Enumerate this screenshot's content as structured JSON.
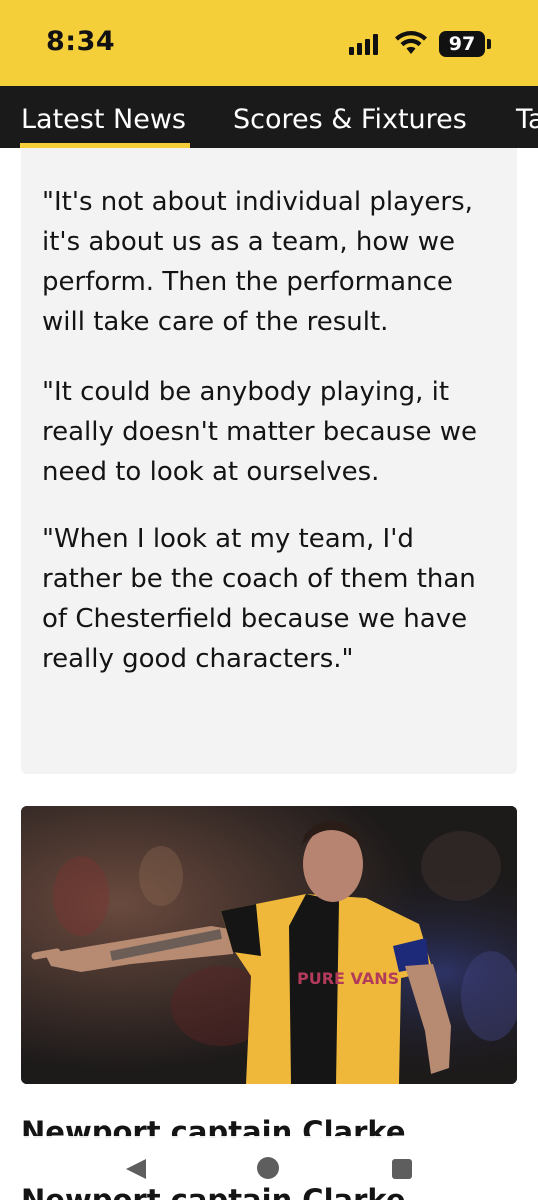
{
  "status_bar": {
    "time": "8:34",
    "battery_level": "97",
    "background_color": "#f5cf3a",
    "icons": [
      "signal-icon",
      "wifi-icon",
      "battery-icon"
    ]
  },
  "tabs": [
    {
      "label": "Latest News",
      "active": true
    },
    {
      "label": "Scores & Fixtures",
      "active": false
    },
    {
      "label": "Ta",
      "active": false
    }
  ],
  "quote": {
    "paragraphs": [
      "\"It's not about individual players, it's about us as a team, how we perform. Then the performance will take care of the result.",
      "\"It could be anybody playing, it really doesn't matter because we need to look at ourselves.",
      "\"When I look at my team, I'd rather be the coach of them than of Chesterfield because we have really good characters.\""
    ]
  },
  "article_image": {
    "shirt_sponsor": "PURE VANS",
    "icon": "player-photo"
  },
  "article": {
    "headline": "Newport captain Clarke",
    "headline_repeat": "Newport captain Clarke"
  },
  "nav": {
    "icons": [
      "back-icon",
      "home-icon",
      "recents-icon"
    ]
  },
  "colors": {
    "accent": "#f5cf3a",
    "tab_bar": "#1a1a1a",
    "card_bg": "#f3f3f3"
  }
}
